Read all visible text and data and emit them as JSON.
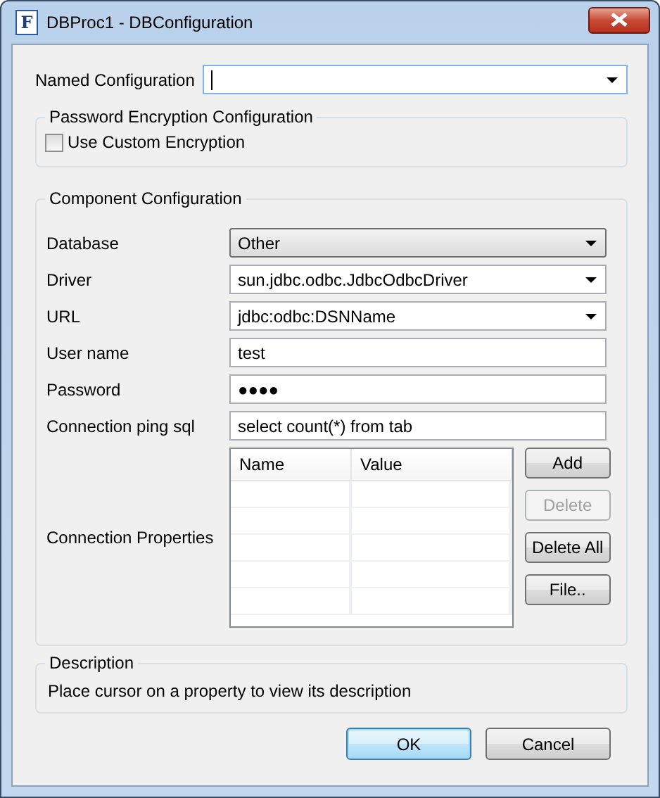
{
  "window": {
    "title": "DBProc1 - DBConfiguration",
    "app_icon": "F"
  },
  "named_configuration": {
    "label": "Named Configuration"
  },
  "encryption_group": {
    "title": "Password Encryption Configuration",
    "checkbox": {
      "label": "Use Custom Encryption",
      "checked": false
    }
  },
  "component_group": {
    "title": "Component Configuration",
    "fields": [
      {
        "label": "Database",
        "kind": "select",
        "value": "Other"
      },
      {
        "label": "Driver",
        "kind": "combo",
        "value": "sun.jdbc.odbc.JdbcOdbcDriver"
      },
      {
        "label": "URL",
        "kind": "combo",
        "value": "jdbc:odbc:DSNName"
      },
      {
        "label": "User name",
        "kind": "text",
        "value": "test"
      },
      {
        "label": "Password",
        "kind": "text",
        "value": "●●●●"
      },
      {
        "label": "Connection ping sql",
        "kind": "text",
        "value": "select count(*) from tab"
      }
    ],
    "properties": {
      "label": "Connection Properties",
      "columns": [
        "Name",
        "Value"
      ],
      "buttons": [
        {
          "label": "Add",
          "disabled": false
        },
        {
          "label": "Delete",
          "disabled": true
        },
        {
          "label": "Delete All",
          "disabled": false
        },
        {
          "label": "File..",
          "disabled": false
        }
      ]
    }
  },
  "description_group": {
    "title": "Description",
    "text": "Place cursor on a property to view its description"
  },
  "buttons": [
    {
      "label": "OK",
      "default": true
    },
    {
      "label": "Cancel",
      "default": false
    }
  ]
}
